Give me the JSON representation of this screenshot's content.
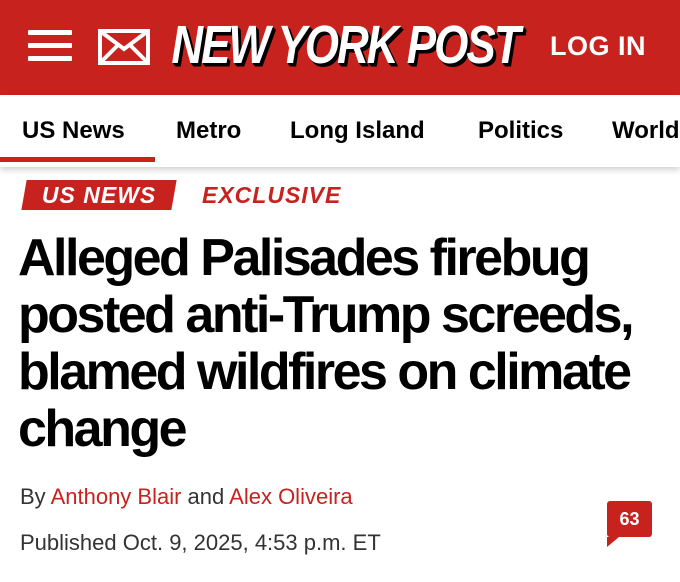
{
  "header": {
    "logo": "NEW YORK POST",
    "login_label": "LOG IN",
    "menu_icon": "hamburger-menu-icon",
    "mail_icon": "envelope-icon",
    "brand_color": "#c8221f"
  },
  "nav": {
    "items": [
      {
        "label": "US News",
        "active": true
      },
      {
        "label": "Metro"
      },
      {
        "label": "Long Island"
      },
      {
        "label": "Politics"
      },
      {
        "label": "World"
      }
    ]
  },
  "article": {
    "section_tag": "US NEWS",
    "secondary_tag": "EXCLUSIVE",
    "headline": "Alleged Palisades firebug posted anti-Trump screeds, blamed wildfires on climate change",
    "byline": {
      "prefix": "By ",
      "authors": [
        "Anthony Blair",
        "Alex Oliveira"
      ],
      "conjunction": " and "
    },
    "published": "Published Oct. 9, 2025, 4:53 p.m. ET",
    "comment_count": "63"
  }
}
